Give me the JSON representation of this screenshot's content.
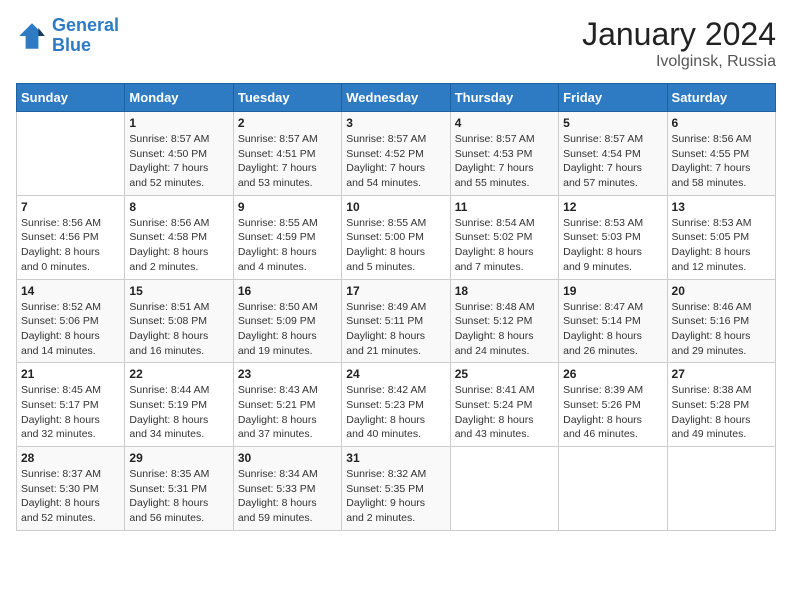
{
  "header": {
    "logo_line1": "General",
    "logo_line2": "Blue",
    "title": "January 2024",
    "subtitle": "Ivolginsk, Russia"
  },
  "weekdays": [
    "Sunday",
    "Monday",
    "Tuesday",
    "Wednesday",
    "Thursday",
    "Friday",
    "Saturday"
  ],
  "weeks": [
    [
      {
        "num": "",
        "info": ""
      },
      {
        "num": "1",
        "info": "Sunrise: 8:57 AM\nSunset: 4:50 PM\nDaylight: 7 hours\nand 52 minutes."
      },
      {
        "num": "2",
        "info": "Sunrise: 8:57 AM\nSunset: 4:51 PM\nDaylight: 7 hours\nand 53 minutes."
      },
      {
        "num": "3",
        "info": "Sunrise: 8:57 AM\nSunset: 4:52 PM\nDaylight: 7 hours\nand 54 minutes."
      },
      {
        "num": "4",
        "info": "Sunrise: 8:57 AM\nSunset: 4:53 PM\nDaylight: 7 hours\nand 55 minutes."
      },
      {
        "num": "5",
        "info": "Sunrise: 8:57 AM\nSunset: 4:54 PM\nDaylight: 7 hours\nand 57 minutes."
      },
      {
        "num": "6",
        "info": "Sunrise: 8:56 AM\nSunset: 4:55 PM\nDaylight: 7 hours\nand 58 minutes."
      }
    ],
    [
      {
        "num": "7",
        "info": "Sunrise: 8:56 AM\nSunset: 4:56 PM\nDaylight: 8 hours\nand 0 minutes."
      },
      {
        "num": "8",
        "info": "Sunrise: 8:56 AM\nSunset: 4:58 PM\nDaylight: 8 hours\nand 2 minutes."
      },
      {
        "num": "9",
        "info": "Sunrise: 8:55 AM\nSunset: 4:59 PM\nDaylight: 8 hours\nand 4 minutes."
      },
      {
        "num": "10",
        "info": "Sunrise: 8:55 AM\nSunset: 5:00 PM\nDaylight: 8 hours\nand 5 minutes."
      },
      {
        "num": "11",
        "info": "Sunrise: 8:54 AM\nSunset: 5:02 PM\nDaylight: 8 hours\nand 7 minutes."
      },
      {
        "num": "12",
        "info": "Sunrise: 8:53 AM\nSunset: 5:03 PM\nDaylight: 8 hours\nand 9 minutes."
      },
      {
        "num": "13",
        "info": "Sunrise: 8:53 AM\nSunset: 5:05 PM\nDaylight: 8 hours\nand 12 minutes."
      }
    ],
    [
      {
        "num": "14",
        "info": "Sunrise: 8:52 AM\nSunset: 5:06 PM\nDaylight: 8 hours\nand 14 minutes."
      },
      {
        "num": "15",
        "info": "Sunrise: 8:51 AM\nSunset: 5:08 PM\nDaylight: 8 hours\nand 16 minutes."
      },
      {
        "num": "16",
        "info": "Sunrise: 8:50 AM\nSunset: 5:09 PM\nDaylight: 8 hours\nand 19 minutes."
      },
      {
        "num": "17",
        "info": "Sunrise: 8:49 AM\nSunset: 5:11 PM\nDaylight: 8 hours\nand 21 minutes."
      },
      {
        "num": "18",
        "info": "Sunrise: 8:48 AM\nSunset: 5:12 PM\nDaylight: 8 hours\nand 24 minutes."
      },
      {
        "num": "19",
        "info": "Sunrise: 8:47 AM\nSunset: 5:14 PM\nDaylight: 8 hours\nand 26 minutes."
      },
      {
        "num": "20",
        "info": "Sunrise: 8:46 AM\nSunset: 5:16 PM\nDaylight: 8 hours\nand 29 minutes."
      }
    ],
    [
      {
        "num": "21",
        "info": "Sunrise: 8:45 AM\nSunset: 5:17 PM\nDaylight: 8 hours\nand 32 minutes."
      },
      {
        "num": "22",
        "info": "Sunrise: 8:44 AM\nSunset: 5:19 PM\nDaylight: 8 hours\nand 34 minutes."
      },
      {
        "num": "23",
        "info": "Sunrise: 8:43 AM\nSunset: 5:21 PM\nDaylight: 8 hours\nand 37 minutes."
      },
      {
        "num": "24",
        "info": "Sunrise: 8:42 AM\nSunset: 5:23 PM\nDaylight: 8 hours\nand 40 minutes."
      },
      {
        "num": "25",
        "info": "Sunrise: 8:41 AM\nSunset: 5:24 PM\nDaylight: 8 hours\nand 43 minutes."
      },
      {
        "num": "26",
        "info": "Sunrise: 8:39 AM\nSunset: 5:26 PM\nDaylight: 8 hours\nand 46 minutes."
      },
      {
        "num": "27",
        "info": "Sunrise: 8:38 AM\nSunset: 5:28 PM\nDaylight: 8 hours\nand 49 minutes."
      }
    ],
    [
      {
        "num": "28",
        "info": "Sunrise: 8:37 AM\nSunset: 5:30 PM\nDaylight: 8 hours\nand 52 minutes."
      },
      {
        "num": "29",
        "info": "Sunrise: 8:35 AM\nSunset: 5:31 PM\nDaylight: 8 hours\nand 56 minutes."
      },
      {
        "num": "30",
        "info": "Sunrise: 8:34 AM\nSunset: 5:33 PM\nDaylight: 8 hours\nand 59 minutes."
      },
      {
        "num": "31",
        "info": "Sunrise: 8:32 AM\nSunset: 5:35 PM\nDaylight: 9 hours\nand 2 minutes."
      },
      {
        "num": "",
        "info": ""
      },
      {
        "num": "",
        "info": ""
      },
      {
        "num": "",
        "info": ""
      }
    ]
  ]
}
